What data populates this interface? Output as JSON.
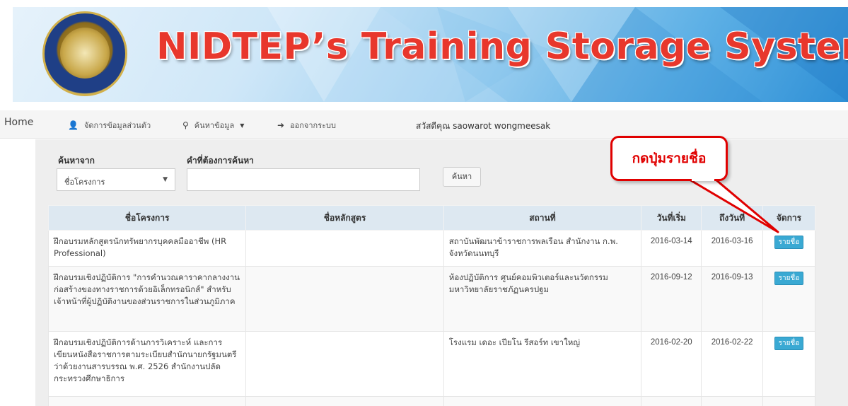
{
  "header": {
    "title": "NIDTEP’s Training Storage System"
  },
  "nav": {
    "home": "Home",
    "profile": "จัดการข้อมูลส่วนตัว",
    "search": "ค้นหาข้อมูล",
    "logout": "ออกจากระบบ",
    "greeting": "สวัสดีคุณ saowarot wongmeesak"
  },
  "search": {
    "from_label": "ค้นหาจาก",
    "keyword_label": "คำที่ต้องการค้นหา",
    "selected": "ชื่อโครงการ",
    "input_value": "",
    "button": "ค้นหา"
  },
  "table": {
    "headers": [
      "ชื่อโครงการ",
      "ชื่อหลักสูตร",
      "สถานที่",
      "วันที่เริ่ม",
      "ถึงวันที่",
      "จัดการ"
    ],
    "rows": [
      {
        "project": "ฝึกอบรมหลักสูตรนักทรัพยากรบุคคลมืออาชีพ (HR Professional)",
        "course": "",
        "place": "สถาบันพัฒนาข้าราชการพลเรือน สำนักงาน ก.พ. จังหวัดนนทบุรี",
        "start": "2016-03-14",
        "end": "2016-03-16",
        "action": "รายชื่อ"
      },
      {
        "project": "ฝึกอบรมเชิงปฏิบัติการ \"การคำนวณคาราคากลางงานก่อสร้างของทางราชการด้วยอิเล็กทรอนิกส์\" สำหรับเจ้าหน้าที่ผู้ปฏิบัติงานของส่วนราชการในส่วนภูมิภาค",
        "course": "",
        "place": "ห้องปฏิบัติการ ศูนย์คอมพิวเตอร์และนวัตกรรม มหาวิทยาลัยราชภัฏนครปฐม",
        "start": "2016-09-12",
        "end": "2016-09-13",
        "action": "รายชื่อ"
      },
      {
        "project": "ฝึกอบรมเชิงปฏิบัติการด้านการวิเคราะห์ และการเขียนหนังสือราชการตามระเบียบสำนักนายกรัฐมนตรีว่าด้วยงานสารบรรณ พ.ศ. 2526 สำนักงานปลัดกระทรวงศึกษาธิการ",
        "course": "",
        "place": "โรงแรม เดอะ เปียโน รีสอร์ท เขาใหญ่",
        "start": "2016-02-20",
        "end": "2016-02-22",
        "action": "รายชื่อ"
      }
    ]
  },
  "callout": {
    "text": "กดปุ่มรายชื่อ"
  },
  "colors": {
    "title_red": "#e8372c",
    "callout_red": "#e00000",
    "button_blue": "#3aa9d3",
    "table_header": "#dde8f1"
  }
}
